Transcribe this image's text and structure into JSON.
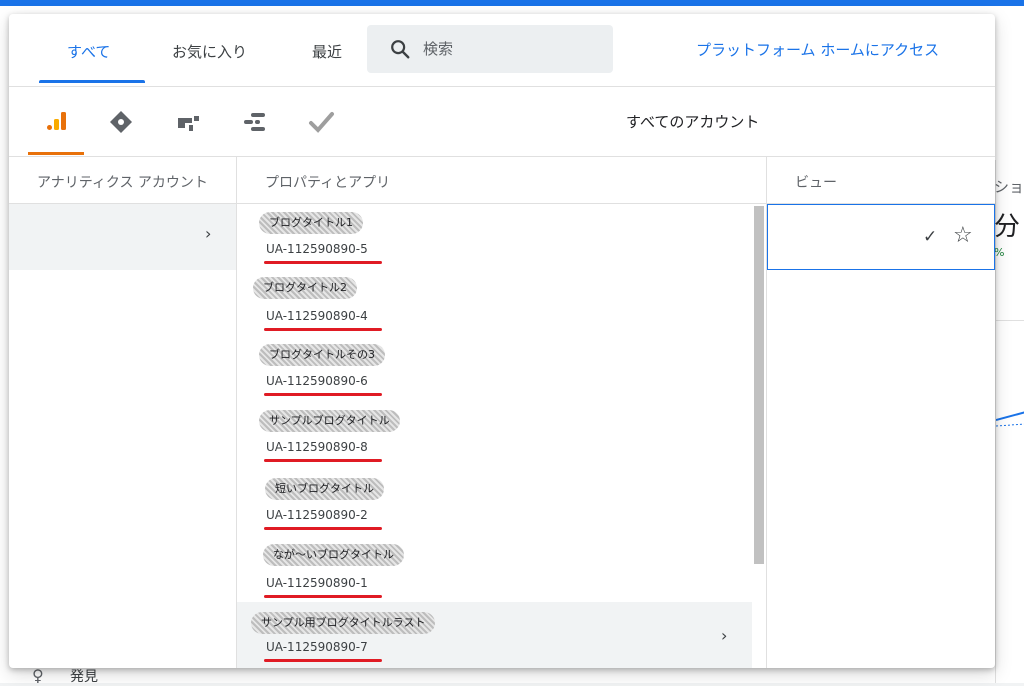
{
  "tabs": [
    {
      "label": "すべて",
      "active": true
    },
    {
      "label": "お気に入り",
      "active": false
    },
    {
      "label": "最近",
      "active": false
    }
  ],
  "search": {
    "placeholder": "検索"
  },
  "platform_link": "プラットフォーム ホームにアクセス",
  "products": {
    "all_accounts_label": "すべてのアカウント",
    "icons": [
      "analytics-icon",
      "tag-manager-icon",
      "optimize-icon",
      "data-studio-icon",
      "surveys-icon"
    ],
    "accent_color": "#e8710a"
  },
  "columns": {
    "accounts_header": "アナリティクス アカウント",
    "properties_header": "プロパティとアプリ",
    "views_header": "ビュー"
  },
  "properties": [
    {
      "name": "ブログタイトル1",
      "id": "UA-112590890-5"
    },
    {
      "name": "ブログタイトル2",
      "id": "UA-112590890-4"
    },
    {
      "name": "ブログタイトルその3",
      "id": "UA-112590890-6"
    },
    {
      "name": "サンプルブログタイトル",
      "id": "UA-112590890-8"
    },
    {
      "name": "短いブログタイトル",
      "id": "UA-112590890-2"
    },
    {
      "name": "なが～いブログタイトル",
      "id": "UA-112590890-1"
    },
    {
      "name": "サンプル用ブログタイトルラスト",
      "id": "UA-112590890-7"
    }
  ],
  "background": {
    "side_label": "発見",
    "right_text_1": "ショ",
    "right_text_2": "分",
    "right_text_3": "%"
  },
  "colors": {
    "accent_blue": "#1a73e8",
    "highlight_red": "#e01b24"
  }
}
